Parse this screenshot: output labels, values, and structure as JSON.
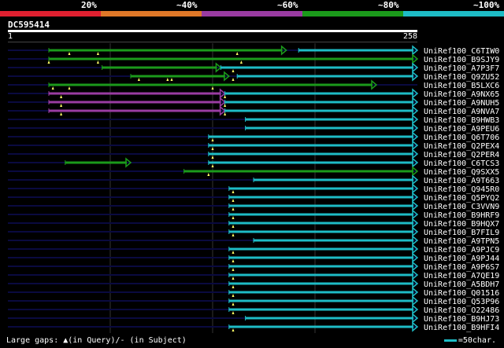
{
  "legend": {
    "labels": [
      "20%",
      "~40%",
      "~60%",
      "~80%",
      "~100%"
    ],
    "colors": [
      "#e02030",
      "#e07828",
      "#9a3ca2",
      "#1b9a1b",
      "#1ebcc6"
    ]
  },
  "query": {
    "title": "DC595414",
    "start": "1",
    "end": "258"
  },
  "hits": [
    {
      "label": "UniRef100_C6TIW0",
      "segments": [
        {
          "s": 10,
          "e": 68,
          "c": "#1b9a1b"
        },
        {
          "s": 71,
          "e": 100,
          "c": "#1ebcc6"
        }
      ],
      "gaps": [
        15,
        22,
        56
      ]
    },
    {
      "label": "UniRef100_B9SJY9",
      "segments": [
        {
          "s": 10,
          "e": 100,
          "c": "#1b9a1b"
        }
      ],
      "gaps": [
        10,
        22,
        57
      ]
    },
    {
      "label": "UniRef100_A7P3F7",
      "segments": [
        {
          "s": 23,
          "e": 52,
          "c": "#1b9a1b"
        },
        {
          "s": 52,
          "e": 100,
          "c": "#1ebcc6"
        }
      ],
      "gaps": [
        55
      ]
    },
    {
      "label": "UniRef100_Q9ZU52",
      "segments": [
        {
          "s": 30,
          "e": 54,
          "c": "#1b9a1b"
        },
        {
          "s": 56,
          "e": 100,
          "c": "#1ebcc6"
        }
      ],
      "gaps": [
        32,
        39,
        40,
        55
      ]
    },
    {
      "label": "UniRef100_B5LXC6",
      "segments": [
        {
          "s": 10,
          "e": 90,
          "c": "#1b9a1b"
        }
      ],
      "gaps": [
        11,
        15,
        50
      ]
    },
    {
      "label": "UniRef100_A9NX65",
      "segments": [
        {
          "s": 10,
          "e": 53,
          "c": "#9a3ca2"
        },
        {
          "s": 53,
          "e": 100,
          "c": "#1ebcc6"
        }
      ],
      "gaps": [
        13,
        53
      ]
    },
    {
      "label": "UniRef100_A9NUH5",
      "segments": [
        {
          "s": 10,
          "e": 53,
          "c": "#9a3ca2"
        },
        {
          "s": 53,
          "e": 100,
          "c": "#1ebcc6"
        }
      ],
      "gaps": [
        13,
        53
      ]
    },
    {
      "label": "UniRef100_A9NVA7",
      "segments": [
        {
          "s": 10,
          "e": 53,
          "c": "#9a3ca2"
        },
        {
          "s": 53,
          "e": 100,
          "c": "#1ebcc6"
        }
      ],
      "gaps": [
        13,
        53
      ]
    },
    {
      "label": "UniRef100_B9HWB3",
      "segments": [
        {
          "s": 58,
          "e": 100,
          "c": "#1ebcc6"
        }
      ],
      "gaps": []
    },
    {
      "label": "UniRef100_A9PEU6",
      "segments": [
        {
          "s": 58,
          "e": 100,
          "c": "#1ebcc6"
        }
      ],
      "gaps": []
    },
    {
      "label": "UniRef100_Q6T706",
      "segments": [
        {
          "s": 49,
          "e": 100,
          "c": "#1ebcc6"
        }
      ],
      "gaps": [
        50
      ]
    },
    {
      "label": "UniRef100_Q2PEX4",
      "segments": [
        {
          "s": 49,
          "e": 100,
          "c": "#1ebcc6"
        }
      ],
      "gaps": [
        50
      ]
    },
    {
      "label": "UniRef100_Q2PER4",
      "segments": [
        {
          "s": 49,
          "e": 100,
          "c": "#1ebcc6"
        }
      ],
      "gaps": [
        50
      ]
    },
    {
      "label": "UniRef100_C6TCS3",
      "segments": [
        {
          "s": 14,
          "e": 30,
          "c": "#1b9a1b"
        },
        {
          "s": 49,
          "e": 100,
          "c": "#1ebcc6"
        }
      ],
      "gaps": [
        50
      ]
    },
    {
      "label": "UniRef100_Q9SXX5",
      "segments": [
        {
          "s": 43,
          "e": 100,
          "c": "#1b9a1b"
        }
      ],
      "gaps": [
        49
      ]
    },
    {
      "label": "UniRef100_A9T663",
      "segments": [
        {
          "s": 60,
          "e": 100,
          "c": "#1ebcc6"
        }
      ],
      "gaps": []
    },
    {
      "label": "UniRef100_Q945R0",
      "segments": [
        {
          "s": 54,
          "e": 100,
          "c": "#1ebcc6"
        }
      ],
      "gaps": [
        55
      ]
    },
    {
      "label": "UniRef100_Q5PYQ2",
      "segments": [
        {
          "s": 54,
          "e": 100,
          "c": "#1ebcc6"
        }
      ],
      "gaps": [
        55
      ]
    },
    {
      "label": "UniRef100_C3VVN9",
      "segments": [
        {
          "s": 54,
          "e": 100,
          "c": "#1ebcc6"
        }
      ],
      "gaps": [
        55
      ]
    },
    {
      "label": "UniRef100_B9HRF9",
      "segments": [
        {
          "s": 54,
          "e": 100,
          "c": "#1ebcc6"
        }
      ],
      "gaps": [
        55
      ]
    },
    {
      "label": "UniRef100_B9HQX7",
      "segments": [
        {
          "s": 54,
          "e": 100,
          "c": "#1ebcc6"
        }
      ],
      "gaps": [
        55
      ]
    },
    {
      "label": "UniRef100_B7FIL9",
      "segments": [
        {
          "s": 54,
          "e": 100,
          "c": "#1ebcc6"
        }
      ],
      "gaps": [
        55
      ]
    },
    {
      "label": "UniRef100_A9TPN5",
      "segments": [
        {
          "s": 60,
          "e": 100,
          "c": "#1ebcc6"
        }
      ],
      "gaps": []
    },
    {
      "label": "UniRef100_A9PJC9",
      "segments": [
        {
          "s": 54,
          "e": 100,
          "c": "#1ebcc6"
        }
      ],
      "gaps": [
        55
      ]
    },
    {
      "label": "UniRef100_A9PJ44",
      "segments": [
        {
          "s": 54,
          "e": 100,
          "c": "#1ebcc6"
        }
      ],
      "gaps": [
        55
      ]
    },
    {
      "label": "UniRef100_A9P6S7",
      "segments": [
        {
          "s": 54,
          "e": 100,
          "c": "#1ebcc6"
        }
      ],
      "gaps": [
        55
      ]
    },
    {
      "label": "UniRef100_A7QE19",
      "segments": [
        {
          "s": 54,
          "e": 100,
          "c": "#1ebcc6"
        }
      ],
      "gaps": [
        55
      ]
    },
    {
      "label": "UniRef100_A5BDH7",
      "segments": [
        {
          "s": 54,
          "e": 100,
          "c": "#1ebcc6"
        }
      ],
      "gaps": [
        55
      ]
    },
    {
      "label": "UniRef100_Q01516",
      "segments": [
        {
          "s": 54,
          "e": 100,
          "c": "#1ebcc6"
        }
      ],
      "gaps": [
        55
      ]
    },
    {
      "label": "UniRef100_Q53P96",
      "segments": [
        {
          "s": 54,
          "e": 100,
          "c": "#1ebcc6"
        }
      ],
      "gaps": [
        55
      ]
    },
    {
      "label": "UniRef100_O22486",
      "segments": [
        {
          "s": 54,
          "e": 100,
          "c": "#1ebcc6"
        }
      ],
      "gaps": [
        55
      ]
    },
    {
      "label": "UniRef100_B9HJ73",
      "segments": [
        {
          "s": 58,
          "e": 100,
          "c": "#1ebcc6"
        }
      ],
      "gaps": []
    },
    {
      "label": "UniRef100_B9HFI4",
      "segments": [
        {
          "s": 54,
          "e": 100,
          "c": "#1ebcc6"
        }
      ],
      "gaps": [
        55
      ]
    }
  ],
  "footer": {
    "gaps_note": "Large gaps: ▲(in Query)/- (in Subject)",
    "scale_note": "=50char."
  }
}
